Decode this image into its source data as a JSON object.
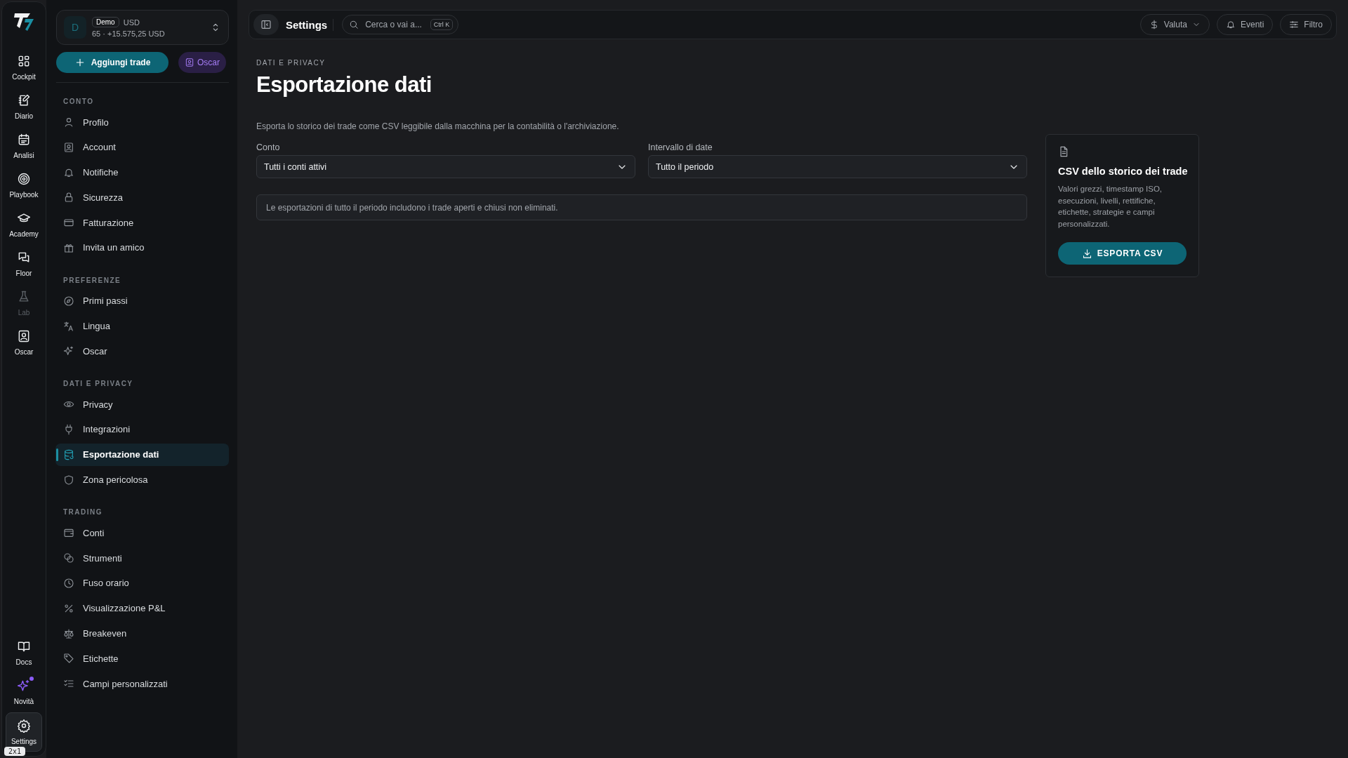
{
  "rail": {
    "items": [
      {
        "label": "Cockpit",
        "disabled": false
      },
      {
        "label": "Diario",
        "disabled": false
      },
      {
        "label": "Analisi",
        "disabled": false
      },
      {
        "label": "Playbook",
        "disabled": false
      },
      {
        "label": "Academy",
        "disabled": false
      },
      {
        "label": "Floor",
        "disabled": false
      },
      {
        "label": "Lab",
        "disabled": true
      },
      {
        "label": "Oscar",
        "disabled": false
      }
    ],
    "bottom_items": [
      {
        "label": "Docs",
        "selected": false,
        "unread": false
      },
      {
        "label": "Novità",
        "selected": false,
        "unread": true
      },
      {
        "label": "Settings",
        "selected": true,
        "unread": false
      }
    ],
    "badge": "2x1"
  },
  "account_switcher": {
    "avatar": "D",
    "mode": "Demo",
    "currency": "USD",
    "summary": "65 · +15.575,25 USD"
  },
  "actions": {
    "add_trade": "Aggiungi trade",
    "oscar": "Oscar"
  },
  "sidebar": {
    "sections": [
      {
        "title": "CONTO",
        "items": [
          {
            "label": "Profilo",
            "selected": false
          },
          {
            "label": "Account",
            "selected": false
          },
          {
            "label": "Notifiche",
            "selected": false
          },
          {
            "label": "Sicurezza",
            "selected": false
          },
          {
            "label": "Fatturazione",
            "selected": false
          },
          {
            "label": "Invita un amico",
            "selected": false
          }
        ]
      },
      {
        "title": "PREFERENZE",
        "items": [
          {
            "label": "Primi passi",
            "selected": false
          },
          {
            "label": "Lingua",
            "selected": false
          },
          {
            "label": "Oscar",
            "selected": false
          }
        ]
      },
      {
        "title": "DATI E PRIVACY",
        "items": [
          {
            "label": "Privacy",
            "selected": false
          },
          {
            "label": "Integrazioni",
            "selected": false
          },
          {
            "label": "Esportazione dati",
            "selected": true
          },
          {
            "label": "Zona pericolosa",
            "selected": false
          }
        ]
      },
      {
        "title": "TRADING",
        "items": [
          {
            "label": "Conti",
            "selected": false
          },
          {
            "label": "Strumenti",
            "selected": false
          },
          {
            "label": "Fuso orario",
            "selected": false
          },
          {
            "label": "Visualizzazione P&L",
            "selected": false
          },
          {
            "label": "Breakeven",
            "selected": false
          },
          {
            "label": "Etichette",
            "selected": false
          },
          {
            "label": "Campi personalizzati",
            "selected": false
          }
        ]
      }
    ]
  },
  "topbar": {
    "title": "Settings",
    "search": {
      "placeholder": "Cerca o vai a...",
      "shortcut": "Ctrl K"
    },
    "buttons": [
      {
        "label": "Valuta",
        "kind": "dropdown"
      },
      {
        "label": "Eventi",
        "kind": "plain"
      },
      {
        "label": "Filtro",
        "kind": "plain"
      }
    ]
  },
  "page": {
    "eyebrow": "DATI E PRIVACY",
    "title": "Esportazione dati",
    "description": "Esporta lo storico dei trade come CSV leggibile dalla macchina per la contabilità o l'archiviazione.",
    "fields": [
      {
        "label": "Conto",
        "value": "Tutti i conti attivi"
      },
      {
        "label": "Intervallo di date",
        "value": "Tutto il periodo"
      }
    ],
    "note": "Le esportazioni di tutto il periodo includono i trade aperti e chiusi non eliminati.",
    "card": {
      "title": "CSV dello storico dei trade",
      "text": "Valori grezzi, timestamp ISO, esecuzioni, livelli, rettifiche, etichette, strategie e campi personalizzati.",
      "button": "ESPORTA CSV"
    }
  }
}
